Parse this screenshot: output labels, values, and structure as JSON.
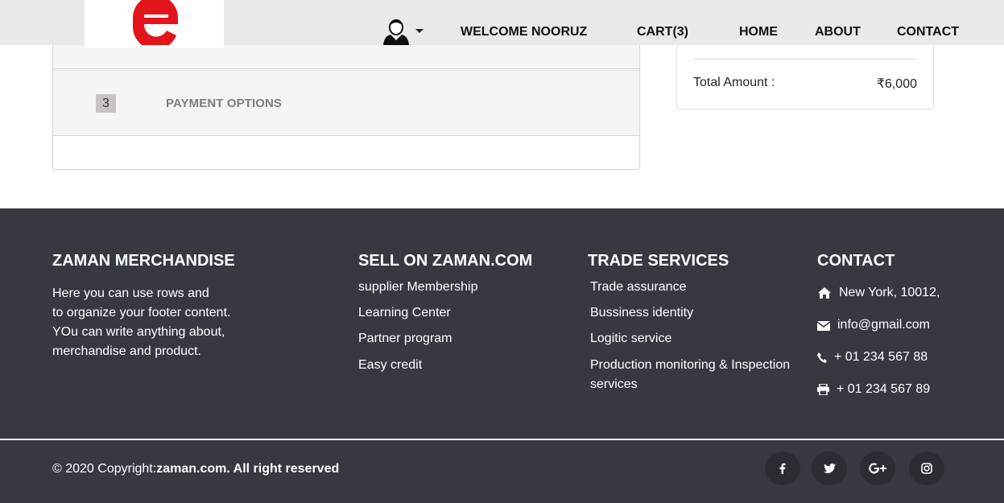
{
  "header": {
    "nav": {
      "welcome": "WELCOME NOORUZ",
      "cart": "CART(3)",
      "home": "HOME",
      "about": "ABOUT",
      "contact": "CONTACT"
    },
    "brand_color": "#e3151a"
  },
  "checkout": {
    "step_number": "3",
    "step_title": "PAYMENT OPTIONS"
  },
  "summary": {
    "total_label": "Total Amount :",
    "total_value": "₹6,000"
  },
  "footer": {
    "about": {
      "title": "ZAMAN MERCHANDISE",
      "lines": [
        "Here you can use rows and",
        "to organize your footer content.",
        "YOu can write anything about,",
        "merchandise and product."
      ]
    },
    "sell": {
      "title": "SELL ON ZAMAN.COM",
      "links": [
        "supplier Membership",
        "Learning Center",
        "Partner program",
        "Easy credit"
      ]
    },
    "trade": {
      "title": "TRADE SERVICES",
      "links": [
        "Trade assurance",
        "Bussiness identity",
        "Logitic service",
        "Production monitoring & Inspection",
        "services"
      ]
    },
    "contact": {
      "title": "CONTACT",
      "address": "New York, 10012,",
      "email": "info@gmail.com",
      "phone": "+ 01 234 567 88",
      "fax": "+ 01 234 567 89"
    },
    "copyright_prefix": "© 2020 Copyright:",
    "copyright_bold": "zaman.com. All right reserved",
    "social_icons": [
      "facebook-icon",
      "twitter-icon",
      "google-plus-icon",
      "instagram-icon"
    ]
  },
  "colors": {
    "footer_bg": "#343a40",
    "header_bg": "#e9e9e9",
    "step_badge": "#c9c3c6"
  }
}
